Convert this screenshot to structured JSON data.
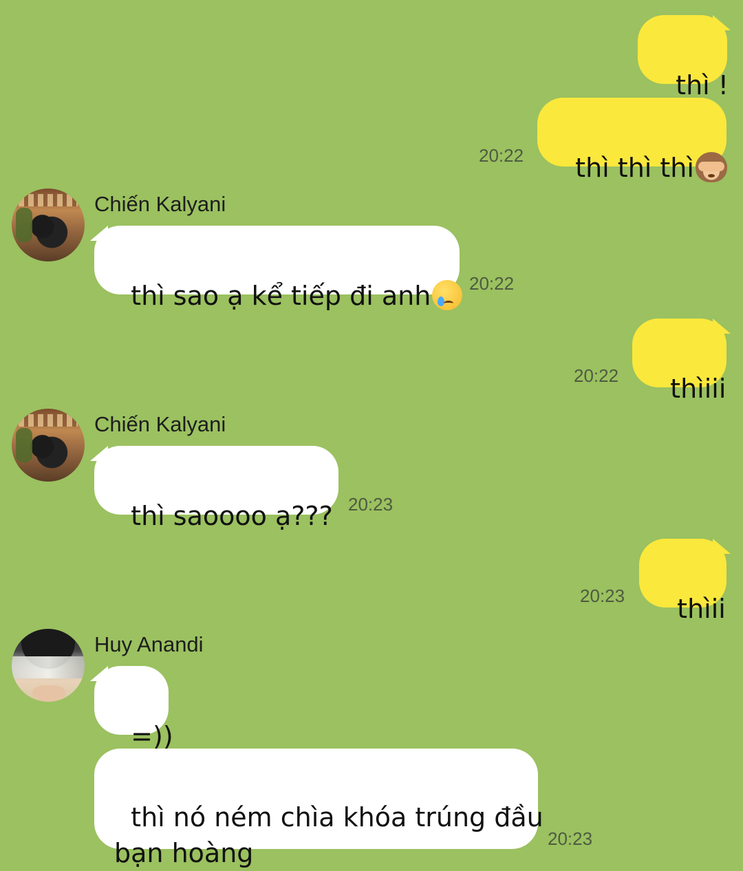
{
  "messages": [
    {
      "text": "thì !",
      "direction": "outgoing",
      "time": ""
    },
    {
      "text": "thì thì thì",
      "emoji": "see-no-evil-monkey-icon",
      "direction": "outgoing",
      "time": "20:22"
    },
    {
      "sender": "Chiến Kalyani",
      "text": "thì sao ạ kể tiếp đi anh",
      "emoji": "crying-face-icon",
      "direction": "incoming",
      "time": "20:22"
    },
    {
      "text": "thìiii",
      "direction": "outgoing",
      "time": "20:22"
    },
    {
      "sender": "Chiến Kalyani",
      "text": "thì saoooo ạ???",
      "direction": "incoming",
      "time": "20:23"
    },
    {
      "text": "thìii",
      "direction": "outgoing",
      "time": "20:23"
    },
    {
      "sender": "Huy Anandi",
      "text": "=))",
      "direction": "incoming",
      "time": ""
    },
    {
      "text": "thì nó ném chìa khóa trúng đầu\nbạn hoàng",
      "direction": "incoming",
      "time": "20:23"
    }
  ],
  "colors": {
    "background": "#9bc160",
    "outgoing_bubble": "#fbe83c",
    "incoming_bubble": "#ffffff",
    "timestamp": "#4e5b41"
  }
}
